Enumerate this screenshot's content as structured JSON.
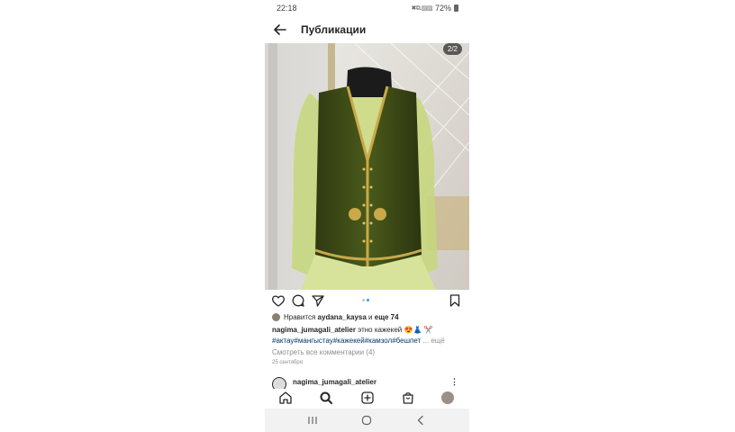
{
  "status_bar": {
    "time": "22:18",
    "indicators": "✖⧉.▨▨",
    "battery": "72%"
  },
  "header": {
    "title": "Публикации"
  },
  "post": {
    "page_counter": "2/2",
    "carousel": {
      "total": 2,
      "active_index": 1
    },
    "likes": {
      "prefix": "Нравится",
      "username": "aydana_kaysa",
      "conjunction": "и",
      "others": "еще 74"
    },
    "caption": {
      "username": "nagima_jumagali_atelier",
      "text": "этно кажекей 😍👗 ✂️"
    },
    "hashtags": "#актау#мангыстау#кажекей#камзол#бешпет",
    "more": "... ещё",
    "view_comments": "Смотреть все комментарии (4)",
    "date": "25 сентября"
  },
  "next_post": {
    "username": "nagima_jumagali_atelier",
    "more_icon": "⋮"
  },
  "bottom_nav": [
    "home-icon",
    "search-icon",
    "new-post-icon",
    "shop-icon",
    "profile-avatar"
  ],
  "system_nav": [
    "recent-apps-icon",
    "home-circle-icon",
    "back-chevron-icon"
  ],
  "colors": {
    "accent_blue": "#3897f0",
    "hashtag": "#00376b",
    "muted": "#8e8e8e",
    "text": "#262626"
  }
}
